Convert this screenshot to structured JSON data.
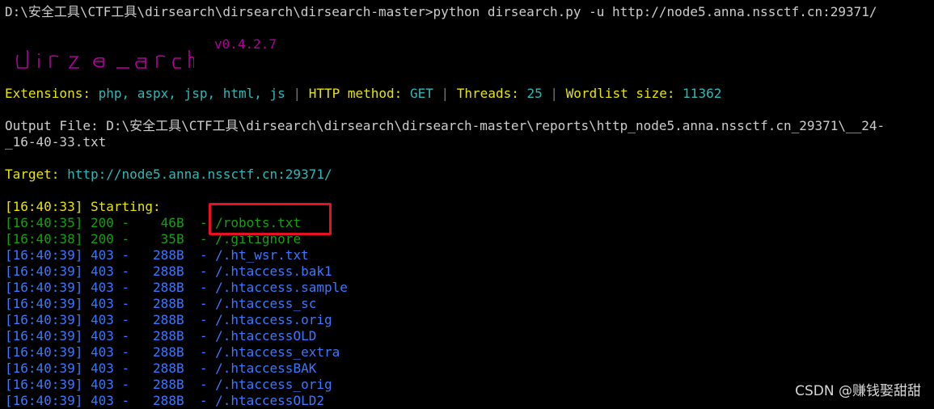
{
  "prompt_line": "D:\\安全工具\\CTF工具\\dirsearch\\dirsearch\\dirsearch-master>python dirsearch.py -u http://node5.anna.nssctf.cn:29371/",
  "banner": {
    "logo_text": "dirsearch",
    "version": "v0.4.2.7"
  },
  "config": {
    "extensions_label": "Extensions:",
    "extensions_value": "php, aspx, jsp, html, js",
    "method_label": "HTTP method:",
    "method_value": "GET",
    "threads_label": "Threads:",
    "threads_value": "25",
    "wordlist_label": "Wordlist size:",
    "wordlist_value": "11362",
    "separator": "|"
  },
  "output_file": {
    "label": "Output File:",
    "path_line1": "D:\\安全工具\\CTF工具\\dirsearch\\dirsearch\\dirsearch-master\\reports\\http_node5.anna.nssctf.cn_29371\\__24-",
    "path_line2": "_16-40-33.txt"
  },
  "target": {
    "label": "Target:",
    "url": "http://node5.anna.nssctf.cn:29371/"
  },
  "starting": {
    "time": "[16:40:33]",
    "text": "Starting:"
  },
  "results": [
    {
      "time": "[16:40:35]",
      "status": "200",
      "size": "46B",
      "path": "/robots.txt",
      "color": "#13a10e"
    },
    {
      "time": "[16:40:38]",
      "status": "200",
      "size": "35B",
      "path": "/.gitignore",
      "color": "#13a10e"
    },
    {
      "time": "[16:40:39]",
      "status": "403",
      "size": "288B",
      "path": "/.ht_wsr.txt",
      "color": "#3b78ff"
    },
    {
      "time": "[16:40:39]",
      "status": "403",
      "size": "288B",
      "path": "/.htaccess.bak1",
      "color": "#3b78ff"
    },
    {
      "time": "[16:40:39]",
      "status": "403",
      "size": "288B",
      "path": "/.htaccess.sample",
      "color": "#3b78ff"
    },
    {
      "time": "[16:40:39]",
      "status": "403",
      "size": "288B",
      "path": "/.htaccess_sc",
      "color": "#3b78ff"
    },
    {
      "time": "[16:40:39]",
      "status": "403",
      "size": "288B",
      "path": "/.htaccess.orig",
      "color": "#3b78ff"
    },
    {
      "time": "[16:40:39]",
      "status": "403",
      "size": "288B",
      "path": "/.htaccessOLD",
      "color": "#3b78ff"
    },
    {
      "time": "[16:40:39]",
      "status": "403",
      "size": "288B",
      "path": "/.htaccess_extra",
      "color": "#3b78ff"
    },
    {
      "time": "[16:40:39]",
      "status": "403",
      "size": "288B",
      "path": "/.htaccessBAK",
      "color": "#3b78ff"
    },
    {
      "time": "[16:40:39]",
      "status": "403",
      "size": "288B",
      "path": "/.htaccess_orig",
      "color": "#3b78ff"
    },
    {
      "time": "[16:40:39]",
      "status": "403",
      "size": "288B",
      "path": "/.htaccessOLD2",
      "color": "#3b78ff"
    }
  ],
  "watermark": "CSDN @赚钱娶甜甜",
  "colors": {
    "background": "#000000",
    "text": "#cccccc",
    "label": "#e6e600",
    "value": "#2fb8b8",
    "ok": "#13a10e",
    "forbidden": "#3b78ff",
    "banner": "#b4009e",
    "highlight": "#e81123"
  }
}
